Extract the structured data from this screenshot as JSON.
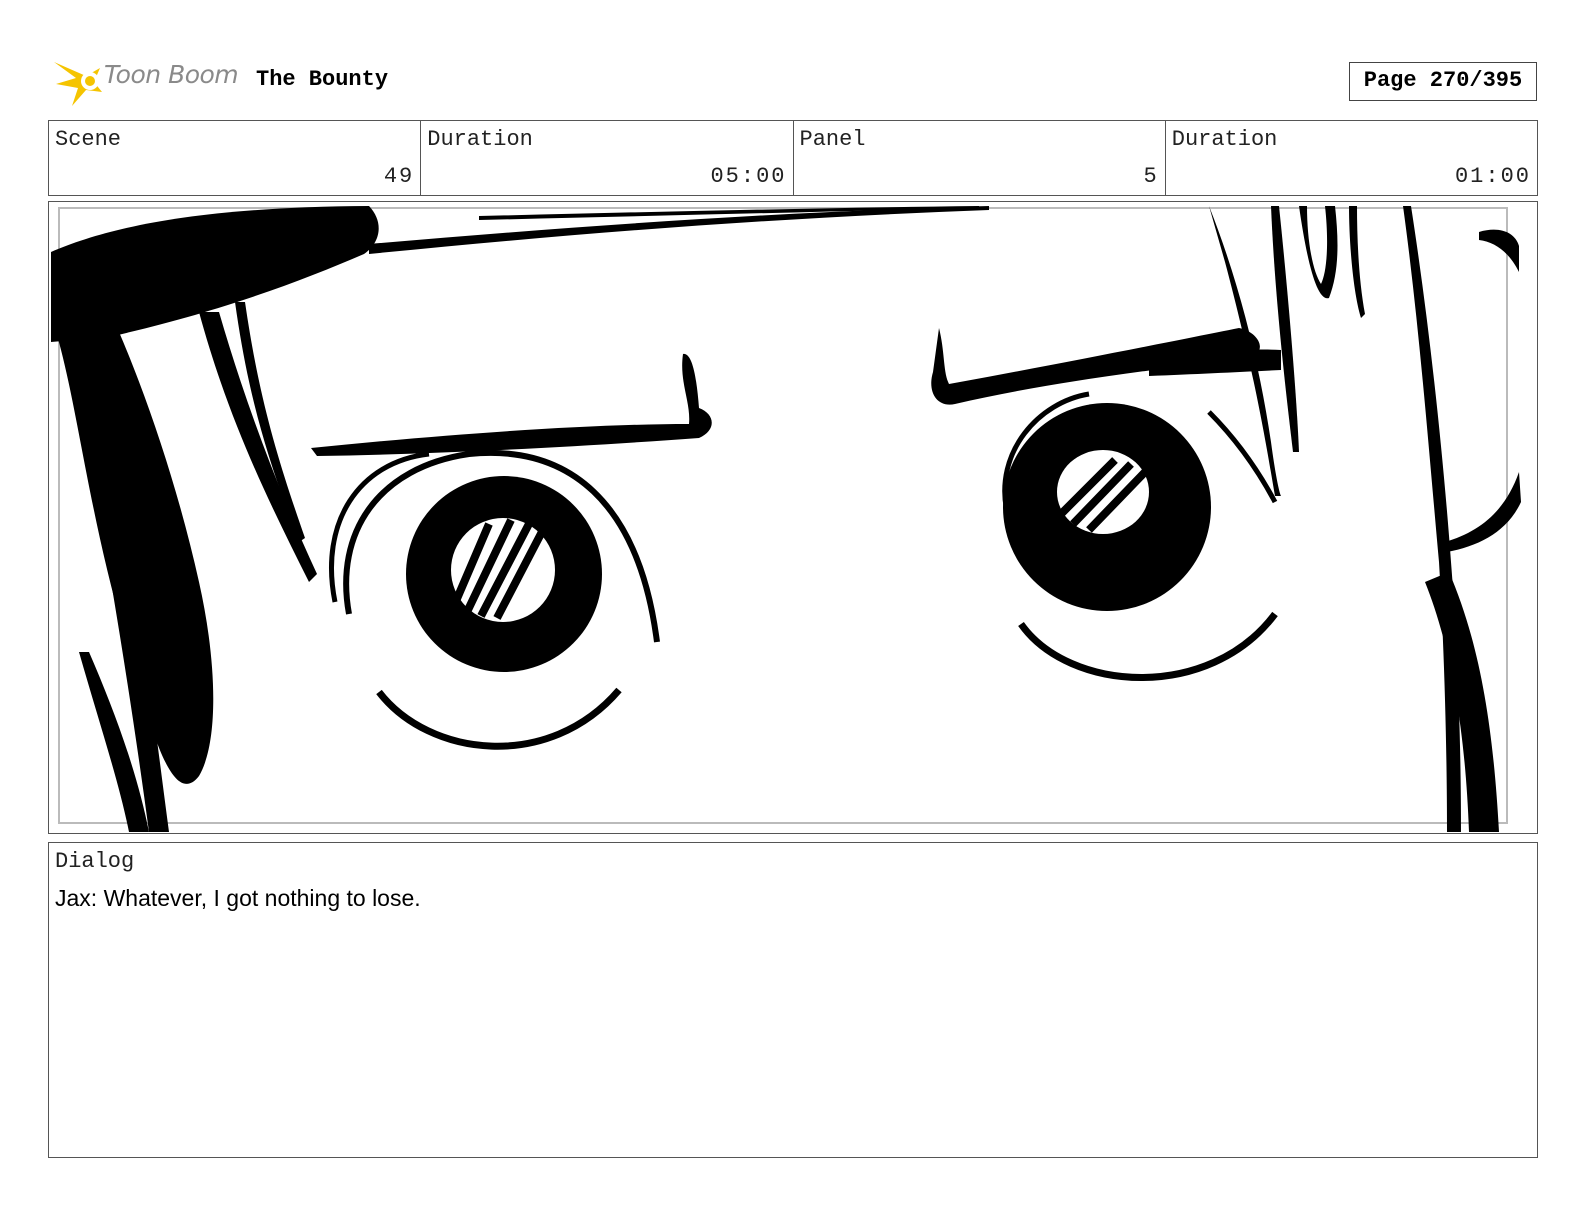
{
  "header": {
    "logo_text": "Toon Boom",
    "title": "The Bounty",
    "page_label": "Page 270/395"
  },
  "info": {
    "scene_label": "Scene",
    "scene_value": "49",
    "scene_duration_label": "Duration",
    "scene_duration_value": "05:00",
    "panel_label": "Panel",
    "panel_value": "5",
    "panel_duration_label": "Duration",
    "panel_duration_value": "01:00"
  },
  "dialog": {
    "label": "Dialog",
    "text": "Jax: Whatever, I got nothing to lose."
  },
  "colors": {
    "logo_accent": "#f5c400",
    "logo_text": "#8a8a8a",
    "ink": "#000000"
  }
}
